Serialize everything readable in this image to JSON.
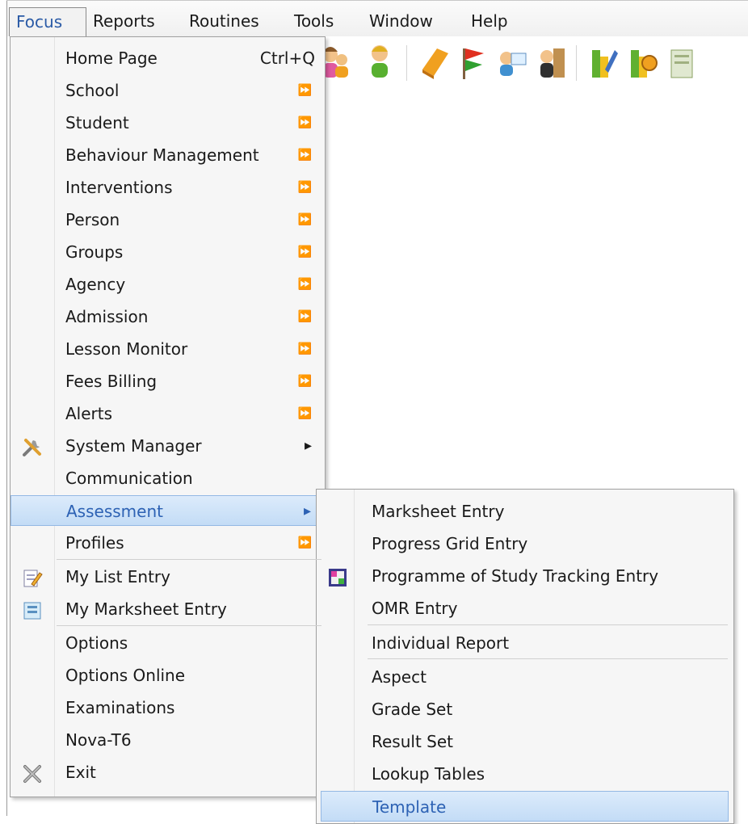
{
  "menubar": [
    "Focus",
    "Reports",
    "Routines",
    "Tools",
    "Window",
    "Help"
  ],
  "focus_menu": {
    "items": [
      {
        "label": "Home Page",
        "shortcut": "Ctrl+Q"
      },
      {
        "label": "School",
        "submenu": true
      },
      {
        "label": "Student",
        "submenu": true
      },
      {
        "label": "Behaviour Management",
        "submenu": true
      },
      {
        "label": "Interventions",
        "submenu": true
      },
      {
        "label": "Person",
        "submenu": true
      },
      {
        "label": "Groups",
        "submenu": true
      },
      {
        "label": "Agency",
        "submenu": true
      },
      {
        "label": "Admission",
        "submenu": true
      },
      {
        "label": "Lesson Monitor",
        "submenu": true
      },
      {
        "label": "Fees Billing",
        "submenu": true
      },
      {
        "label": "Alerts",
        "submenu": true
      },
      {
        "label": "System Manager",
        "submenu": true,
        "icon": "tools-icon"
      },
      {
        "label": "Communication"
      },
      {
        "label": "Assessment",
        "submenu": true,
        "highlighted": true
      },
      {
        "label": "Profiles",
        "submenu": true
      },
      {
        "label": "My List Entry",
        "icon": "list-edit-icon"
      },
      {
        "label": "My Marksheet Entry",
        "icon": "marksheet-icon"
      },
      {
        "label": "Options"
      },
      {
        "label": "Options Online"
      },
      {
        "label": "Examinations"
      },
      {
        "label": "Nova-T6"
      },
      {
        "label": "Exit",
        "icon": "exit-icon"
      }
    ]
  },
  "assessment_submenu": {
    "items": [
      {
        "label": "Marksheet Entry"
      },
      {
        "label": "Progress Grid Entry"
      },
      {
        "label": "Programme of Study Tracking Entry",
        "icon": "tracking-icon"
      },
      {
        "label": "OMR Entry"
      },
      {
        "label": "Individual Report"
      },
      {
        "label": "Aspect"
      },
      {
        "label": "Grade Set"
      },
      {
        "label": "Result Set"
      },
      {
        "label": "Lookup Tables"
      },
      {
        "label": "Template",
        "highlighted": true
      }
    ]
  },
  "colors": {
    "highlight": "#c3dcf6",
    "highlight_text": "#2d62b4",
    "accent": "#2a5aa6"
  }
}
